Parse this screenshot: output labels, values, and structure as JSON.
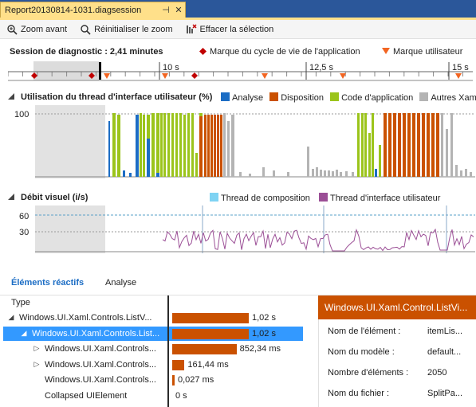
{
  "tab": {
    "title": "Report20130814-1031.diagsession",
    "pin": "⊣",
    "close": "✕"
  },
  "toolbar": {
    "zoom_in": "Zoom avant",
    "reset_zoom": "Réinitialiser le zoom",
    "clear_selection": "Effacer la sélection"
  },
  "session": {
    "label": "Session de diagnostic : 2,41 minutes",
    "legend_lifecycle": "Marque du cycle de vie de l'application",
    "legend_user": "Marque utilisateur"
  },
  "ruler": {
    "ticks": [
      "10 s",
      "12,5 s",
      "15 s"
    ]
  },
  "ui_thread": {
    "title": "Utilisation du thread d'interface utilisateur (%)",
    "y_label": "100",
    "legend": [
      {
        "label": "Analyse",
        "color": "#1c6dc4"
      },
      {
        "label": "Disposition",
        "color": "#ca5100"
      },
      {
        "label": "Code d'application",
        "color": "#9bc41b"
      },
      {
        "label": "Autres Xaml",
        "color": "#b4b4b4"
      }
    ]
  },
  "visual": {
    "title": "Débit visuel (i/s)",
    "y60": "60",
    "y30": "30",
    "legend": [
      {
        "label": "Thread de composition",
        "color": "#7fd3f3"
      },
      {
        "label": "Thread d'interface utilisateur",
        "color": "#9b4f96"
      }
    ]
  },
  "bottom": {
    "tabs": [
      "Éléments réactifs",
      "Analyse"
    ],
    "type_header": "Type",
    "tree": [
      {
        "label": "Windows.UI.Xaml.Controls.ListV...",
        "level": 0,
        "expander": "◢",
        "duration": "1,02 s",
        "fraction": 1.0
      },
      {
        "label": "Windows.UI.Xaml.Controls.List...",
        "level": 1,
        "expander": "◢",
        "duration": "1,02 s",
        "fraction": 1.0,
        "selected": true
      },
      {
        "label": "Windows.UI.Xaml.Controls...",
        "level": 2,
        "expander": "▷",
        "duration": "852,34 ms",
        "fraction": 0.84
      },
      {
        "label": "Windows.UI.Xaml.Controls...",
        "level": 2,
        "expander": "▷",
        "duration": "161,44 ms",
        "fraction": 0.16
      },
      {
        "label": "Windows.UI.Xaml.Controls...",
        "level": 2,
        "expander": "",
        "duration": "0,027 ms",
        "fraction": 0.01
      },
      {
        "label": "Collapsed UIElement",
        "level": 2,
        "expander": "",
        "duration": "0 s",
        "fraction": 0.0
      }
    ],
    "details": {
      "header": "Windows.UI.Xaml.Control.ListVi...",
      "rows": [
        {
          "key": "Nom de l'élément :",
          "value": "itemLis..."
        },
        {
          "key": "Nom du modèle :",
          "value": "default..."
        },
        {
          "key": "Nombre d'éléments :",
          "value": "2050"
        },
        {
          "key": "Nom du fichier :",
          "value": "SplitPa..."
        }
      ]
    }
  },
  "colors": {
    "accent": "#2b579a",
    "tab_active": "#ffe08a",
    "selection": "#3399ff",
    "lifecycle_mark": "#c00000",
    "user_mark": "#f26522"
  }
}
